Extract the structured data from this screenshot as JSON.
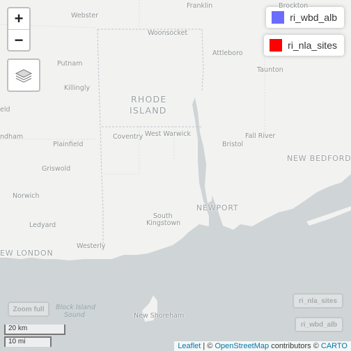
{
  "colors": {
    "land": "#f2f2f0",
    "water": "#cfd4d6",
    "ri_wbd_alb": "#6b6bff",
    "ri_nla_sites": "#ff0000"
  },
  "zoom": {
    "in_label": "+",
    "out_label": "−"
  },
  "layers_control": {
    "icon": "layers-icon"
  },
  "legend": [
    {
      "label": "ri_wbd_alb",
      "color": "#6b6bff"
    },
    {
      "label": "ri_nla_sites",
      "color": "#ff0000"
    }
  ],
  "places": {
    "franklin": "Franklin",
    "brockton": "Brockton",
    "webster": "Webster",
    "woonsocket": "Woonsocket",
    "attleboro": "Attleboro",
    "putnam": "Putnam",
    "taunton": "Taunton",
    "killingly": "Killingly",
    "rhode": "RHODE",
    "island": "ISLAND",
    "eld": "eld",
    "west_warwick": "West Warwick",
    "coventry": "Coventry",
    "fall_river": "Fall River",
    "ndham": "ndham",
    "plainfield": "Plainfield",
    "bristol": "Bristol",
    "new_bedford": "NEW BEDFORD",
    "griswold": "Griswold",
    "norwich": "Norwich",
    "newport": "NEWPORT",
    "ledyard": "Ledyard",
    "south": "South",
    "kingstown": "Kingstown",
    "westerly": "Westerly",
    "new_london": "EW LONDON",
    "block_island_sound_1": "Block Island",
    "block_island_sound_2": "Sound",
    "new_shoreham": "New Shoreham"
  },
  "buttons": {
    "zoom_full": "Zoom full",
    "ri_nla_sites": "ri_nla_sites",
    "ri_wbd_alb": "ri_wbd_alb"
  },
  "scale": {
    "km": "20 km",
    "mi": "10 mi"
  },
  "attribution": {
    "leaflet": "Leaflet",
    "sep1": " | © ",
    "osm": "OpenStreetMap",
    "mid": " contributors © ",
    "carto": "CARTO"
  }
}
